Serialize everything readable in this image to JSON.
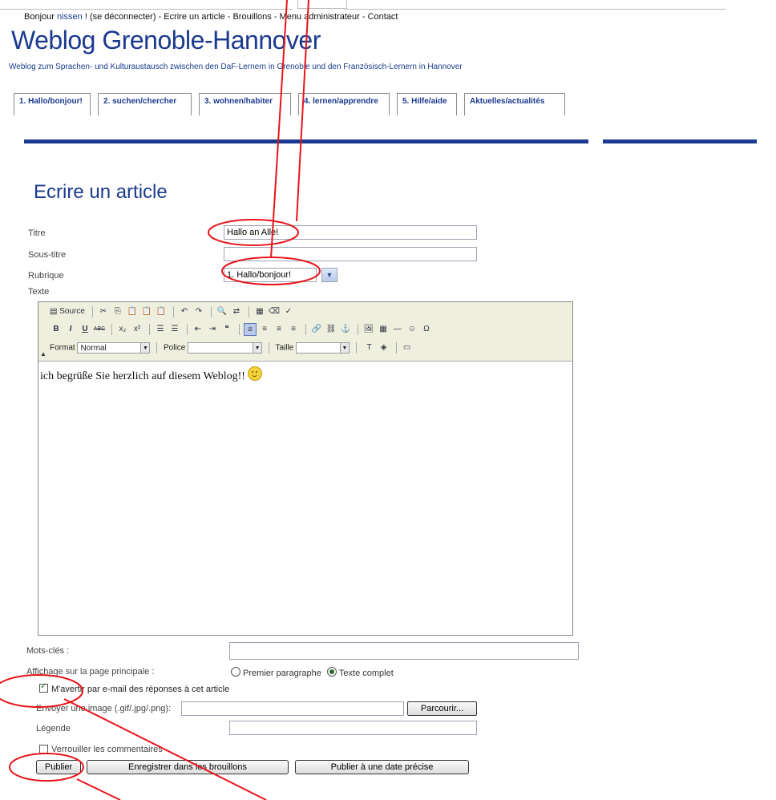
{
  "header": {
    "greeting": "Bonjour ",
    "user": "nissen",
    "links_text": " ! (se déconnecter) - Ecrire un article - Brouillons - Menu administrateur - Contact",
    "site_title": "Weblog Grenoble-Hannover",
    "site_subtitle": "Weblog zum Sprachen- und Kulturaustausch zwischen den DaF-Lernern in Grenoble und den Französisch-Lernern in Hannover"
  },
  "tabs": [
    {
      "label": "1. Hallo/bonjour!"
    },
    {
      "label": "2. suchen/chercher"
    },
    {
      "label": "3. wohnen/habiter"
    },
    {
      "label": "4. lernen/apprendre"
    },
    {
      "label": "5. Hilfe/aide"
    },
    {
      "label": "Aktuelles/actualités"
    }
  ],
  "page_title": "Ecrire un article",
  "form": {
    "titre_label": "Titre",
    "titre_value": "Hallo an Alle!",
    "sous_titre_label": "Sous-titre",
    "sous_titre_value": "",
    "rubrique_label": "Rubrique",
    "rubrique_value": "1. Hallo/bonjour!",
    "texte_label": "Texte",
    "mots_cles_label": "Mots-clés :",
    "mots_cles_value": "",
    "affichage_label": "Affichage sur la page principale :",
    "radio_premier": "Premier paragraphe",
    "radio_complet": "Texte complet",
    "radio_selected": "Texte complet",
    "avertir_label": "M'avertir par e-mail des réponses à cet article",
    "avertir_checked": true,
    "image_label": "Envoyer une image (.gif/.jpg/.png):",
    "browse_button": "Parcourir...",
    "legende_label": "Légende",
    "verrouiller_label": "Verrouiller les commentaires",
    "verrouiller_checked": false,
    "publier_button": "Publier",
    "brouillons_button": "Enregistrer dans les brouillons",
    "date_button": "Publier à une date précise"
  },
  "editor": {
    "source_label": "Source",
    "format_label": "Format",
    "format_value": "Normal",
    "police_label": "Police",
    "police_value": "",
    "taille_label": "Taille",
    "taille_value": "",
    "content_text": "ich begrüße Sie herzlich auf diesem Weblog!!",
    "toolbar_icons_row1": [
      "cut-icon",
      "copy-icon",
      "paste-icon",
      "paste-text-icon",
      "paste-word-icon",
      "undo-icon",
      "redo-icon",
      "find-icon",
      "replace-icon",
      "select-all-icon",
      "remove-format-icon",
      "spellcheck-icon"
    ],
    "toolbar_icons_row2": [
      "bold-icon",
      "italic-icon",
      "underline-icon",
      "strike-icon",
      "subscript-icon",
      "superscript-icon",
      "ordered-list-icon",
      "unordered-list-icon",
      "outdent-icon",
      "indent-icon",
      "blockquote-icon",
      "align-left-icon",
      "align-center-icon",
      "align-right-icon",
      "justify-icon",
      "link-icon",
      "unlink-icon",
      "anchor-icon",
      "image-icon",
      "table-icon",
      "rule-icon",
      "smiley-icon",
      "special-char-icon"
    ]
  },
  "colors": {
    "brand": "#1b3a8f",
    "annotation": "#e8141a",
    "toolbar_bg": "#efefde"
  }
}
